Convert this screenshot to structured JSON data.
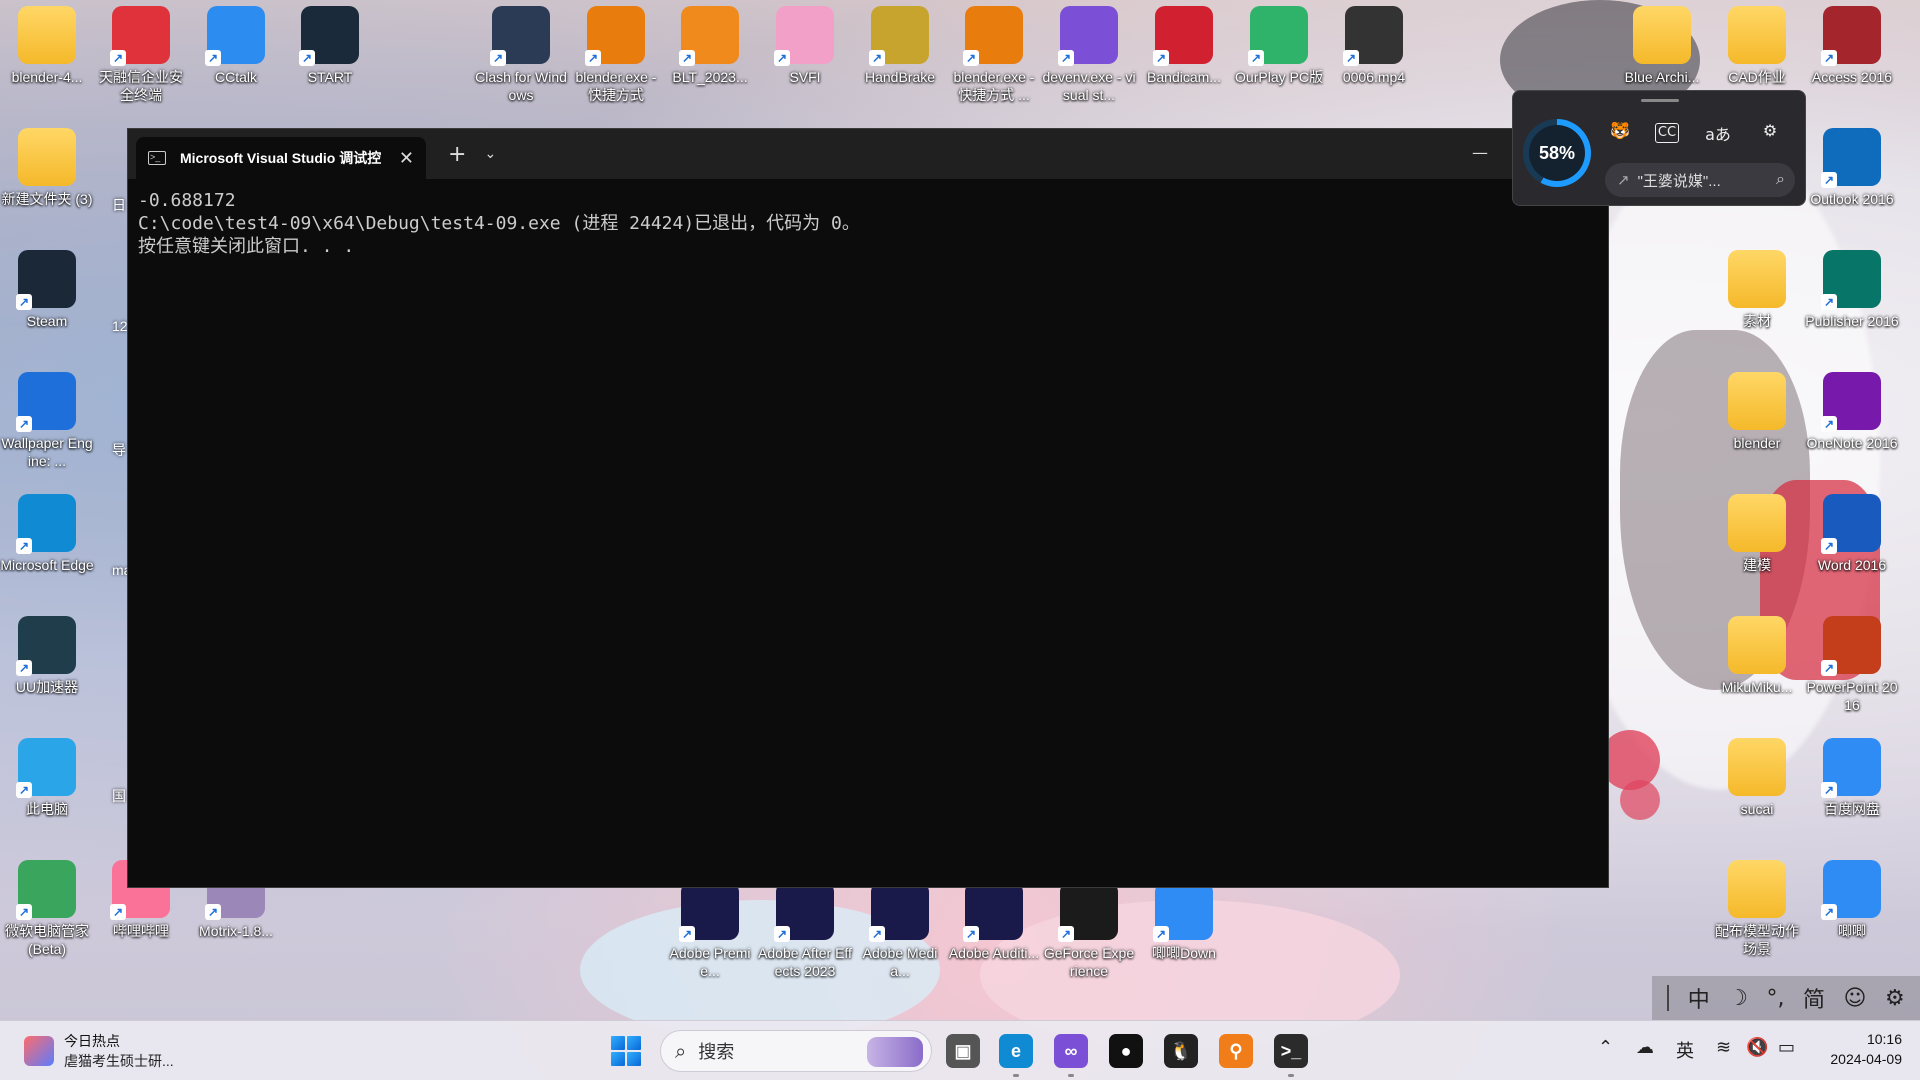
{
  "desktop": {
    "icons_top": [
      {
        "label": "blender-4...",
        "icon": "folder-icon",
        "color": "#f5b92a"
      },
      {
        "label": "天融信企业安全终端",
        "icon": "shield-app-icon",
        "color": "#e0323b"
      },
      {
        "label": "CCtalk",
        "icon": "cctalk-icon",
        "color": "#2d8cf0"
      },
      {
        "label": "START",
        "icon": "start-app-icon",
        "color": "#1a2a3a"
      },
      {
        "label": "Clash for Windows",
        "icon": "cat-icon",
        "color": "#2b3a55"
      },
      {
        "label": "blender.exe - 快捷方式",
        "icon": "blender-icon",
        "color": "#e87d0d"
      },
      {
        "label": "BLT_2023...",
        "icon": "blt-icon",
        "color": "#f08a1c"
      },
      {
        "label": "SVFI",
        "icon": "svfi-icon",
        "color": "#f3a0c8"
      },
      {
        "label": "HandBrake",
        "icon": "pineapple-icon",
        "color": "#c7a42e"
      },
      {
        "label": "blender.exe - 快捷方式 ...",
        "icon": "blender-icon",
        "color": "#e87d0d"
      },
      {
        "label": "devenv.exe - visual st...",
        "icon": "visual-studio-icon",
        "color": "#7b4fd6"
      },
      {
        "label": "Bandicam...",
        "icon": "bandicam-icon",
        "color": "#d1202f"
      },
      {
        "label": "OurPlay PC版",
        "icon": "ourplay-icon",
        "color": "#2fb36b"
      },
      {
        "label": "0006.mp4",
        "icon": "video-file-icon",
        "color": "#333333"
      },
      {
        "label": "Blue Archi...",
        "icon": "folder-icon",
        "color": "#f5b92a"
      },
      {
        "label": "CAD作业",
        "icon": "folder-icon",
        "color": "#f5b92a"
      },
      {
        "label": "Access 2016",
        "icon": "access-icon",
        "color": "#a4262c"
      }
    ],
    "icons_left": [
      {
        "label": "新建文件夹 (3)",
        "icon": "folder-icon",
        "color": "#f5b92a"
      },
      {
        "label": "Steam",
        "icon": "steam-icon",
        "color": "#1b2838"
      },
      {
        "label": "Wallpaper Engine: ...",
        "icon": "wallpaper-engine-icon",
        "color": "#1e6fd9"
      },
      {
        "label": "Microsoft Edge",
        "icon": "edge-icon",
        "color": "#0f8ad3"
      },
      {
        "label": "UU加速器",
        "icon": "uu-icon",
        "color": "#1f3d4a"
      },
      {
        "label": "此电脑",
        "icon": "computer-icon",
        "color": "#2aa6e8"
      },
      {
        "label": "微软电脑管家 (Beta)",
        "icon": "pc-manager-icon",
        "color": "#3aa55d"
      },
      {
        "label": "哔哩哔哩",
        "icon": "bilibili-icon",
        "color": "#fb7299"
      },
      {
        "label": "Motrix-1.8...",
        "icon": "motrix-icon",
        "color": "#9b87b8"
      }
    ],
    "icons_right": [
      {
        "label": "Outlook 2016",
        "icon": "outlook-icon",
        "color": "#0f6cbd"
      },
      {
        "label": "素材",
        "icon": "folder-icon",
        "color": "#f5b92a"
      },
      {
        "label": "Publisher 2016",
        "icon": "publisher-icon",
        "color": "#077568"
      },
      {
        "label": "blender",
        "icon": "folder-icon",
        "color": "#f5b92a"
      },
      {
        "label": "OneNote 2016",
        "icon": "onenote-icon",
        "color": "#7719aa"
      },
      {
        "label": "建模",
        "icon": "folder-icon",
        "color": "#f5b92a"
      },
      {
        "label": "Word 2016",
        "icon": "word-icon",
        "color": "#185abd"
      },
      {
        "label": "MikuMiku...",
        "icon": "folder-icon",
        "color": "#f5b92a"
      },
      {
        "label": "PowerPoint 2016",
        "icon": "powerpoint-icon",
        "color": "#c43e1c"
      },
      {
        "label": "sucai",
        "icon": "folder-icon",
        "color": "#f5b92a"
      },
      {
        "label": "百度网盘",
        "icon": "baidu-netdisk-icon",
        "color": "#2f8cf5"
      },
      {
        "label": "配布模型动作场景",
        "icon": "folder-icon",
        "color": "#f5b92a"
      },
      {
        "label": "唧唧",
        "icon": "jiji-icon",
        "color": "#2f8cf5"
      }
    ],
    "icons_bottom": [
      {
        "label": "Adobe Premie...",
        "icon": "premiere-icon",
        "color": "#1a1a4a"
      },
      {
        "label": "Adobe After Effects 2023",
        "icon": "after-effects-icon",
        "color": "#1a1a4a"
      },
      {
        "label": "Adobe Media...",
        "icon": "media-encoder-icon",
        "color": "#1a1a4a"
      },
      {
        "label": "Adobe Auditi...",
        "icon": "audition-icon",
        "color": "#1a1a4a"
      },
      {
        "label": "GeForce Experience",
        "icon": "geforce-icon",
        "color": "#1b1b1b"
      },
      {
        "label": "唧唧Down",
        "icon": "jijidown-icon",
        "color": "#2f8cf5"
      }
    ],
    "partial_labels": [
      "日",
      "12",
      "导",
      "mat",
      "国"
    ]
  },
  "terminal": {
    "tab_title": "Microsoft Visual Studio 调试控",
    "new_tab": "+",
    "dropdown": "⌄",
    "close": "✕",
    "minimize": "—",
    "lines": [
      "-0.688172",
      "C:\\code\\test4-09\\x64\\Debug\\test4-09.exe (进程 24424)已退出，代码为 0。",
      "按任意键关闭此窗口. . ."
    ]
  },
  "widget": {
    "gauge_value": "58%",
    "gauge_fraction": 0.58,
    "search_text": "\"王婆说媒\"...",
    "icons": [
      "tiger-icon",
      "cc-icon",
      "translate-icon",
      "gear-icon"
    ],
    "translate_label": "aあ",
    "cc_label": "CC"
  },
  "ime": {
    "items": [
      "中",
      "☽",
      "°,",
      "简",
      "☺",
      "⚙"
    ]
  },
  "taskbar": {
    "news_title": "今日热点",
    "news_subtitle": "虐猫考生硕士研...",
    "search_placeholder": "搜索",
    "tray_lang": "英",
    "time": "10:16",
    "date": "2024-04-09",
    "apps": [
      {
        "icon": "task-view-icon",
        "color": "#555555"
      },
      {
        "icon": "edge-icon",
        "color": "#0f8ad3"
      },
      {
        "icon": "visual-studio-icon",
        "color": "#7b4fd6"
      },
      {
        "icon": "github-icon",
        "color": "#111111"
      },
      {
        "icon": "qq-icon",
        "color": "#222222"
      },
      {
        "icon": "search-everything-icon",
        "color": "#f07d1a"
      },
      {
        "icon": "terminal-icon",
        "color": "#2b2b2b"
      }
    ]
  }
}
